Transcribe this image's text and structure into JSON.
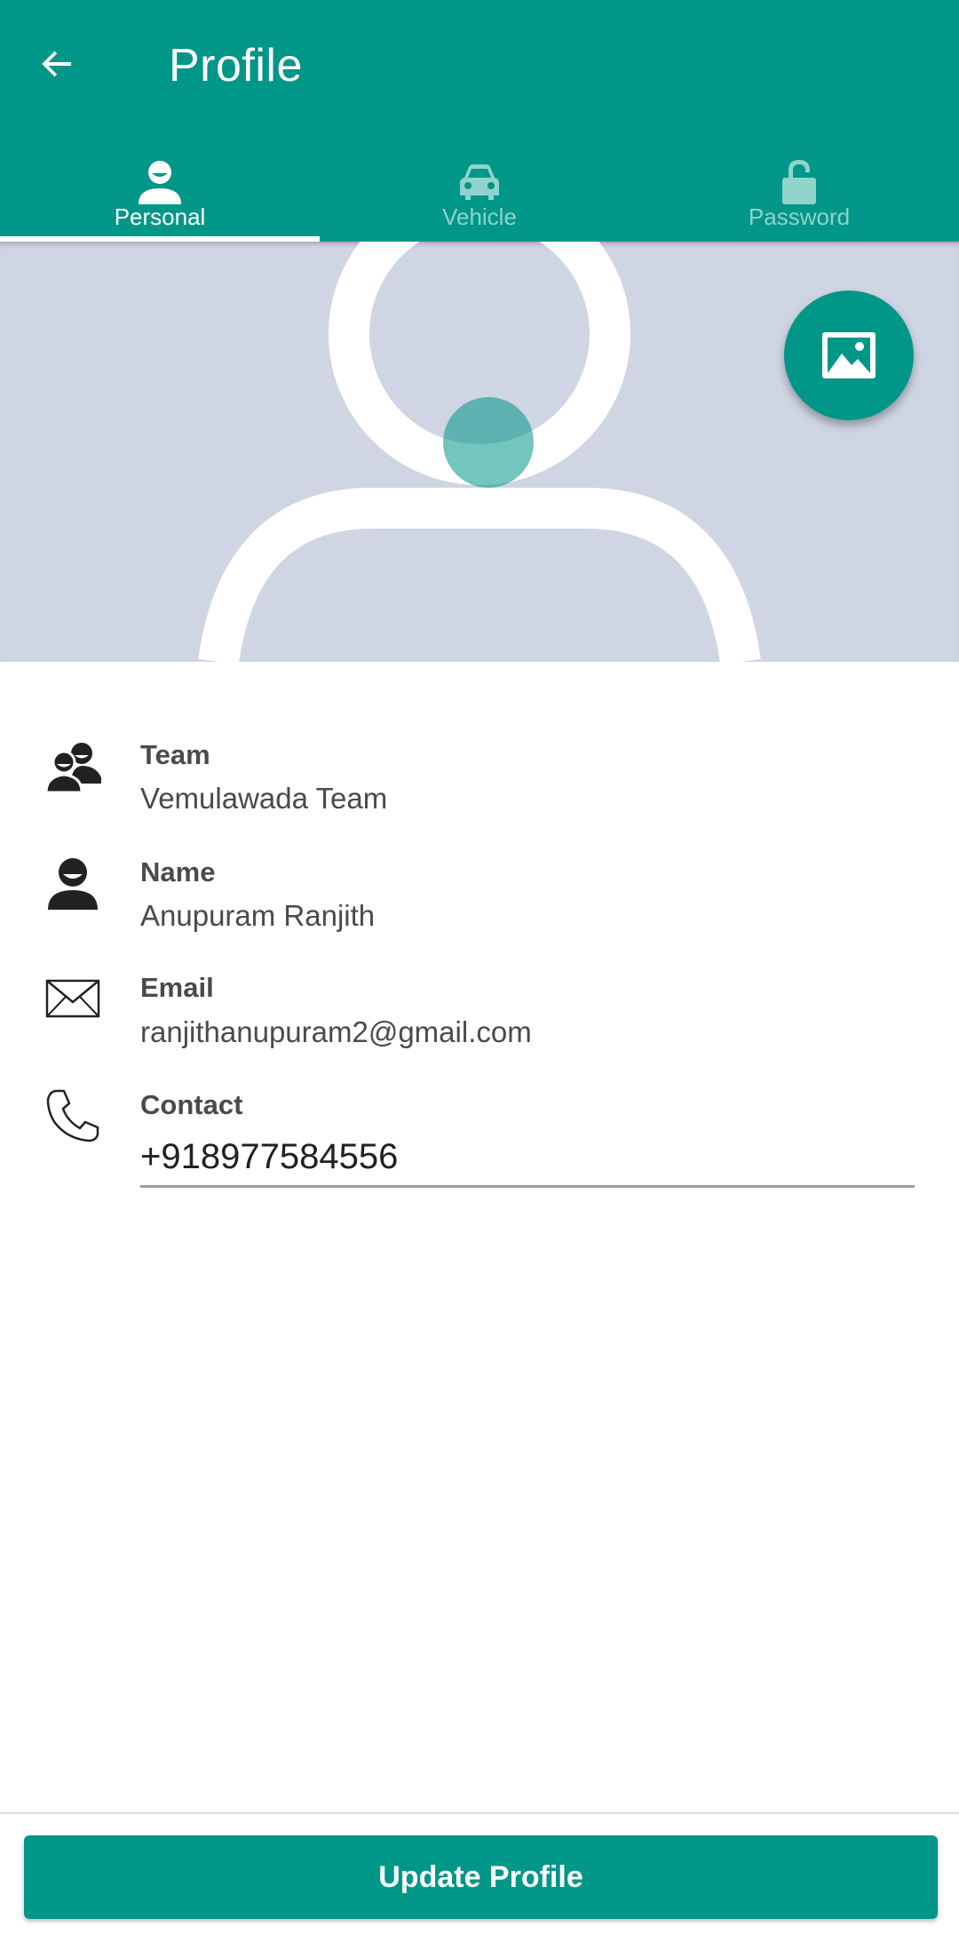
{
  "app_bar": {
    "title": "Profile",
    "back_icon": "arrow-left-icon",
    "background_color": "#009688"
  },
  "tabs": [
    {
      "label": "Personal",
      "icon": "person-icon",
      "active": true
    },
    {
      "label": "Vehicle",
      "icon": "car-icon",
      "active": false
    },
    {
      "label": "Password",
      "icon": "lock-open-icon",
      "active": false
    }
  ],
  "photo": {
    "placeholder_icon": "avatar-placeholder-icon",
    "change_photo_icon": "image-icon",
    "background_color": "#cfd5e3"
  },
  "fields": {
    "team": {
      "label": "Team",
      "value": "Vemulawada Team",
      "icon": "group-icon"
    },
    "name": {
      "label": "Name",
      "value": "Anupuram Ranjith",
      "icon": "person-icon"
    },
    "email": {
      "label": "Email",
      "value": "ranjithanupuram2@gmail.com",
      "icon": "envelope-icon"
    },
    "contact": {
      "label": "Contact",
      "value": "+918977584556",
      "icon": "phone-icon"
    }
  },
  "actions": {
    "update_label": "Update Profile"
  }
}
